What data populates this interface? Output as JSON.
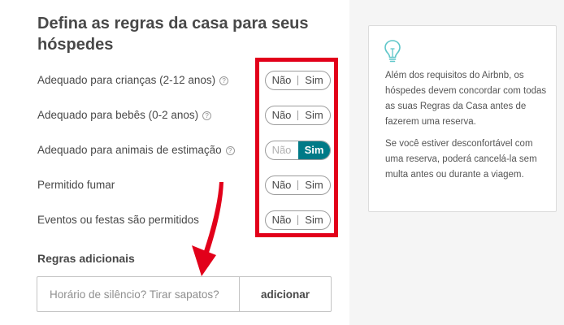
{
  "page": {
    "title": "Defina as regras da casa para seus hóspedes"
  },
  "rules": [
    {
      "label": "Adequado para crianças (2-12 anos)",
      "has_help": true,
      "value": "Não"
    },
    {
      "label": "Adequado para bebês (0-2 anos)",
      "has_help": true,
      "value": "Não"
    },
    {
      "label": "Adequado para animais de estimação",
      "has_help": true,
      "value": "Sim"
    },
    {
      "label": "Permitido fumar",
      "has_help": false,
      "value": "Não"
    },
    {
      "label": "Eventos ou festas são permitidos",
      "has_help": false,
      "value": "Não"
    }
  ],
  "toggle": {
    "no_label": "Não",
    "yes_label": "Sim"
  },
  "help_glyph": "?",
  "additional_rules": {
    "label": "Regras adicionais",
    "input_value": "",
    "input_placeholder": "Horário de silêncio? Tirar sapatos?",
    "add_button_label": "adicionar"
  },
  "info_card": {
    "icon": "lightbulb-icon",
    "paragraph_1": "Além dos requisitos do Airbnb, os hóspedes devem concordar com todas as suas Regras da Casa antes de fazerem uma reserva.",
    "paragraph_2": "Se você estiver desconfortável com uma reserva, poderá cancelá-la sem multa antes ou durante a viagem."
  },
  "colors": {
    "accent_teal": "#007a87",
    "highlight_red": "#e2001a",
    "text_dark": "#484848",
    "sidebar_bg": "#f5f5f5",
    "bulb_stroke": "#5ec6c9"
  }
}
